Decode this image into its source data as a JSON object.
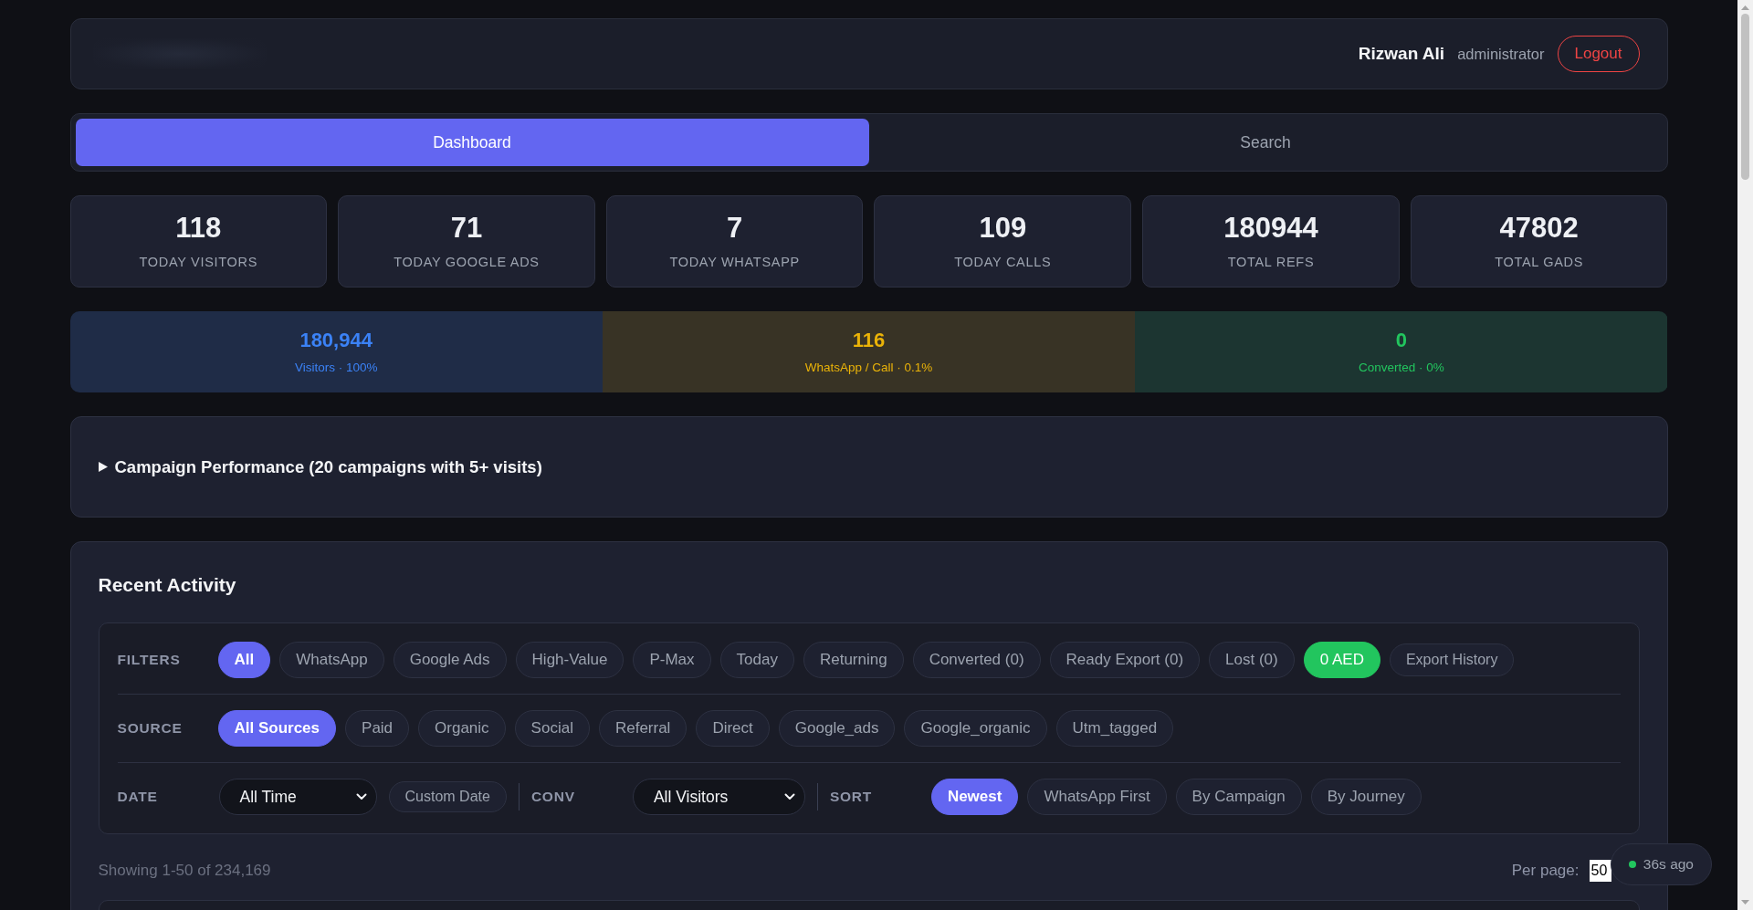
{
  "header": {
    "user_name": "Rizwan Ali",
    "role": "administrator",
    "logout": "Logout"
  },
  "tabs": [
    {
      "label": "Dashboard",
      "selected": true
    },
    {
      "label": "Search",
      "selected": false
    }
  ],
  "stats": [
    {
      "value": "118",
      "label": "TODAY VISITORS"
    },
    {
      "value": "71",
      "label": "TODAY GOOGLE ADS"
    },
    {
      "value": "7",
      "label": "TODAY WHATSAPP"
    },
    {
      "value": "109",
      "label": "TODAY CALLS"
    },
    {
      "value": "180944",
      "label": "TOTAL REFS"
    },
    {
      "value": "47802",
      "label": "TOTAL GADS"
    }
  ],
  "funnel": [
    {
      "value": "180,944",
      "label": "Visitors · 100%",
      "color": "#3b82f6"
    },
    {
      "value": "116",
      "label": "WhatsApp / Call · 0.1%",
      "color": "#eab308"
    },
    {
      "value": "0",
      "label": "Converted · 0%",
      "color": "#22c55e"
    }
  ],
  "campaign_panel": {
    "title": "Campaign Performance (20 campaigns with 5+ visits)",
    "expanded": false
  },
  "recent_activity": {
    "title": "Recent Activity",
    "filters": {
      "label": "FILTERS",
      "chips": [
        {
          "label": "All",
          "selected": true,
          "kind": "filter"
        },
        {
          "label": "WhatsApp",
          "selected": false,
          "kind": "filter"
        },
        {
          "label": "Google Ads",
          "selected": false,
          "kind": "filter"
        },
        {
          "label": "High-Value",
          "selected": false,
          "kind": "filter"
        },
        {
          "label": "P-Max",
          "selected": false,
          "kind": "filter"
        },
        {
          "label": "Today",
          "selected": false,
          "kind": "filter"
        },
        {
          "label": "Returning",
          "selected": false,
          "kind": "filter"
        },
        {
          "label": "Converted (0)",
          "selected": false,
          "kind": "filter"
        },
        {
          "label": "Ready Export (0)",
          "selected": false,
          "kind": "filter"
        },
        {
          "label": "Lost (0)",
          "selected": false,
          "kind": "filter"
        },
        {
          "label": "0 AED",
          "selected": false,
          "kind": "amount"
        },
        {
          "label": "Export History",
          "selected": false,
          "kind": "action"
        }
      ]
    },
    "source": {
      "label": "SOURCE",
      "chips": [
        {
          "label": "All Sources",
          "selected": true,
          "kind": "filter"
        },
        {
          "label": "Paid",
          "selected": false,
          "kind": "filter"
        },
        {
          "label": "Organic",
          "selected": false,
          "kind": "filter"
        },
        {
          "label": "Social",
          "selected": false,
          "kind": "filter"
        },
        {
          "label": "Referral",
          "selected": false,
          "kind": "filter"
        },
        {
          "label": "Direct",
          "selected": false,
          "kind": "filter"
        },
        {
          "label": "Google_ads",
          "selected": false,
          "kind": "filter"
        },
        {
          "label": "Google_organic",
          "selected": false,
          "kind": "filter"
        },
        {
          "label": "Utm_tagged",
          "selected": false,
          "kind": "filter"
        }
      ]
    },
    "date": {
      "label": "DATE",
      "select": {
        "value": "All Time"
      },
      "custom": {
        "label": "Custom Date"
      }
    },
    "conv": {
      "label": "CONV",
      "select": {
        "value": "All Visitors"
      }
    },
    "sort": {
      "label": "SORT",
      "chips": [
        {
          "label": "Newest",
          "selected": true,
          "kind": "filter"
        },
        {
          "label": "WhatsApp First",
          "selected": false,
          "kind": "filter"
        },
        {
          "label": "By Campaign",
          "selected": false,
          "kind": "filter"
        },
        {
          "label": "By Journey",
          "selected": false,
          "kind": "filter"
        }
      ]
    },
    "showing": "Showing 1-50 of 234,169",
    "per_page": {
      "label": "Per page:",
      "value": "50"
    }
  },
  "status_toast": {
    "text": "36s ago"
  }
}
